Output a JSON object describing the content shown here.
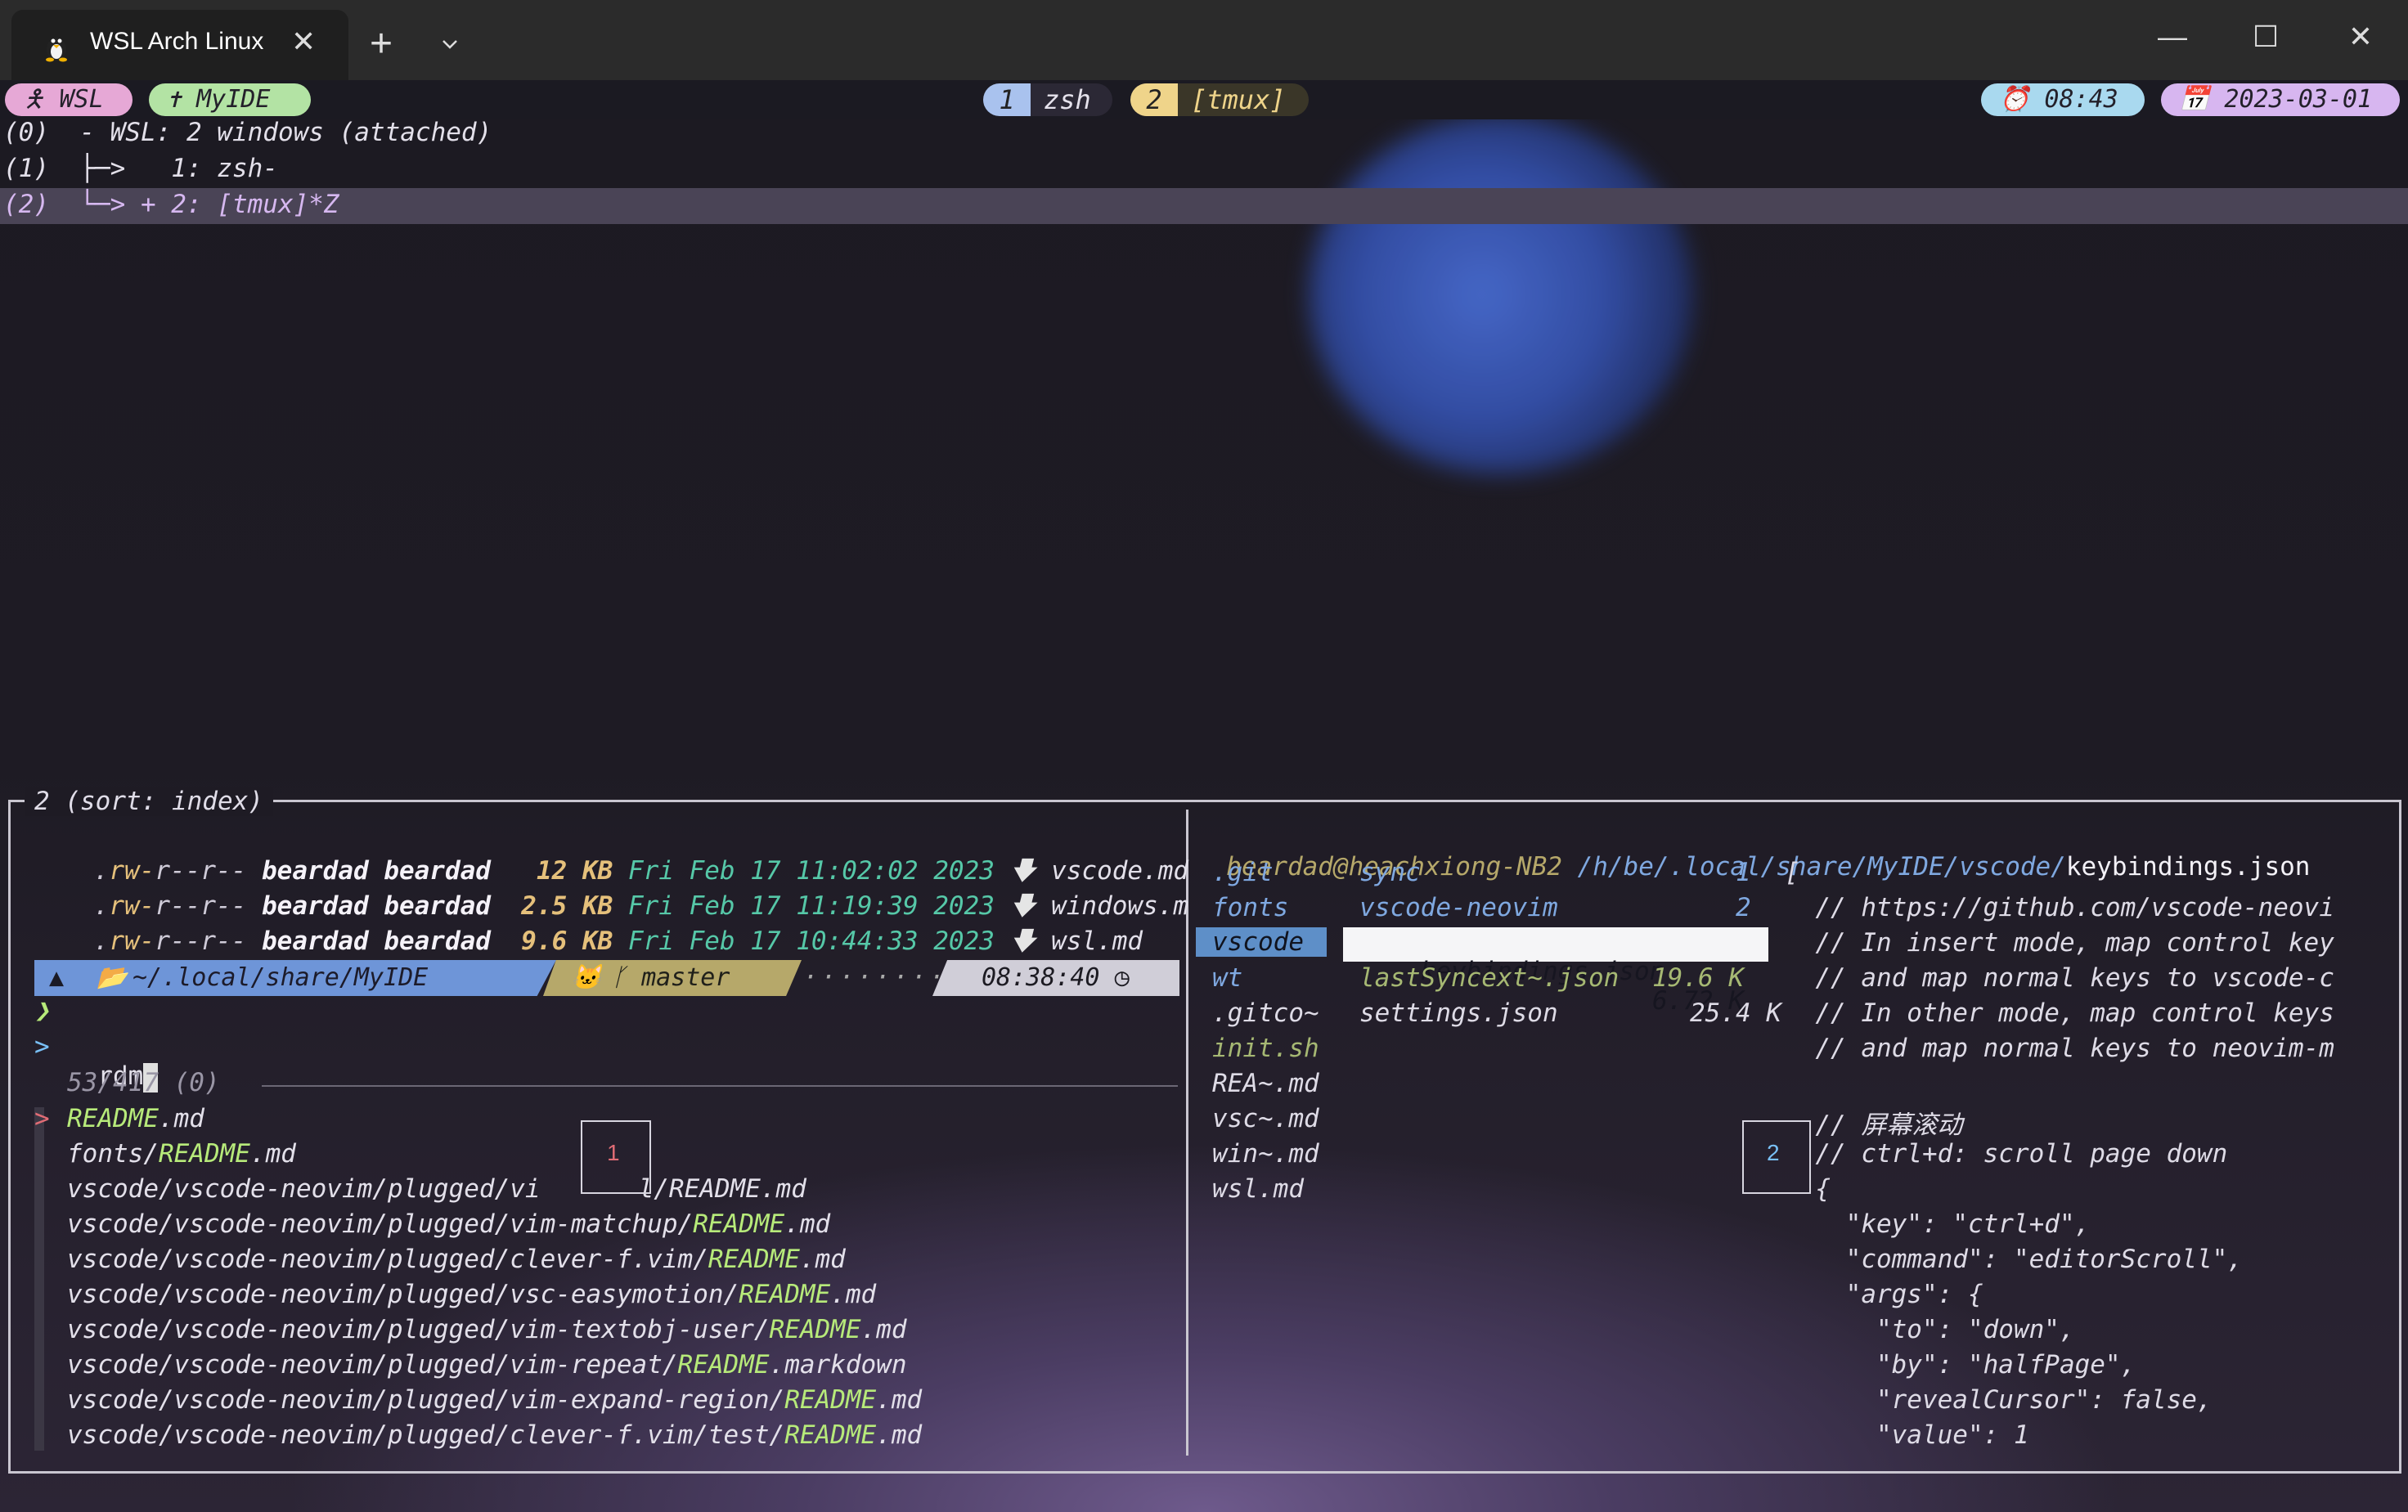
{
  "window": {
    "tab_title": "WSL Arch Linux",
    "tab_close": "✕",
    "new_tab": "+",
    "min": "—",
    "max": "☐",
    "close": "✕"
  },
  "status": {
    "session": "WSL",
    "left2": "MyIDE",
    "win1_num": "1",
    "win1_name": "zsh",
    "win2_num": "2",
    "win2_name": "[tmux]",
    "clock": "08:43",
    "date": "2023-03-01"
  },
  "tree": {
    "line0": "(0)  - WSL: 2 windows (attached)",
    "line1": "(1)  ├─>   1: zsh-",
    "line2": "(2)  └─> + 2: [tmux]*Z"
  },
  "pane": {
    "title": "2 (sort: index)"
  },
  "ls": [
    {
      "perm_pre": ".",
      "perm_r1": "rw-",
      "perm_r2": "r--",
      "perm_r3": "r--",
      "user": "beardad beardad",
      "size": " 12 KB",
      "date": "Fri Feb 17 11:02:02 2023",
      "arrow": "🡇",
      "name": "vscode.md"
    },
    {
      "perm_pre": ".",
      "perm_r1": "rw-",
      "perm_r2": "r--",
      "perm_r3": "r--",
      "user": "beardad beardad",
      "size": "2.5 KB",
      "date": "Fri Feb 17 11:19:39 2023",
      "arrow": "🡇",
      "name": "windows.m"
    },
    {
      "perm_pre": ".",
      "perm_r1": "rw-",
      "perm_r2": "r--",
      "perm_r3": "r--",
      "user": "beardad beardad",
      "size": "9.6 KB",
      "date": "Fri Feb 17 10:44:33 2023",
      "arrow": "🡇",
      "name": "wsl.md"
    }
  ],
  "prompt": {
    "path": "~/.local/share/MyIDE",
    "branch": "master",
    "dots": "········",
    "time": "08:38:40",
    "chevron": "❯",
    "input_marker": ">",
    "input": "rdm",
    "count": "53/417 (0)"
  },
  "fzf": {
    "selected_marker": ">",
    "items": [
      {
        "pre": "",
        "hl": "README",
        "post": ".md"
      },
      {
        "pre": "fonts/",
        "hl": "README",
        "post": ".md"
      },
      {
        "pre": "vscode/vscode-neovim/plugged/vi",
        "hl": "",
        "post": "l/README.md"
      },
      {
        "pre": "vscode/vscode-neovim/plugged/vim-matchup/",
        "hl": "README",
        "post": ".md"
      },
      {
        "pre": "vscode/vscode-neovim/plugged/clever-f.vim/",
        "hl": "README",
        "post": ".md"
      },
      {
        "pre": "vscode/vscode-neovim/plugged/vsc-easymotion/",
        "hl": "README",
        "post": ".md"
      },
      {
        "pre": "vscode/vscode-neovim/plugged/vim-textobj-user/",
        "hl": "README",
        "post": ".md"
      },
      {
        "pre": "vscode/vscode-neovim/plugged/vim-repeat/",
        "hl": "README",
        "post": ".markdown"
      },
      {
        "pre": "vscode/vscode-neovim/plugged/vim-expand-region/",
        "hl": "README",
        "post": ".md"
      },
      {
        "pre": "vscode/vscode-neovim/plugged/clever-f.vim/test/",
        "hl": "README",
        "post": ".md"
      }
    ],
    "mark1": "1",
    "mark2": "2"
  },
  "lf": {
    "header_user": "beardad@heachxiong-NB2",
    "header_path": "/h/be/.local/share/MyIDE/vscode/",
    "header_file": "keybindings.json",
    "col1": [
      ".git",
      "fonts",
      "vscode",
      "wt",
      ".gitco~",
      "init.sh",
      "REA~.md",
      "vsc~.md",
      "win~.md",
      "wsl.md"
    ],
    "col2": [
      {
        "name": "sync",
        "info": "1"
      },
      {
        "name": "vscode-neovim",
        "info": "2"
      },
      {
        "name": "keybindings.json",
        "info": "6.72 K"
      },
      {
        "name": "lastSyncext~.json",
        "info": "19.6 K"
      },
      {
        "name": "settings.json",
        "info": "25.4 K"
      }
    ],
    "preview": [
      "[",
      "  // https://github.com/vscode-neovi",
      "  // In insert mode, map control key",
      "  // and map normal keys to vscode-c",
      "  // In other mode, map control keys",
      "  // and map normal keys to neovim-m",
      "",
      "  // 屏幕滚动",
      "  // ctrl+d: scroll page down",
      "  {",
      "    \"key\": \"ctrl+d\",",
      "    \"command\": \"editorScroll\",",
      "    \"args\": {",
      "      \"to\": \"down\",",
      "      \"by\": \"halfPage\",",
      "      \"revealCursor\": false,",
      "      \"value\": 1"
    ]
  },
  "colors": {
    "accent_blue": "#6e95d8",
    "accent_yellow": "#b6a86a",
    "match_green": "#b7ea7a",
    "date_teal": "#56c8a8",
    "size_yellow": "#e5c07b"
  }
}
